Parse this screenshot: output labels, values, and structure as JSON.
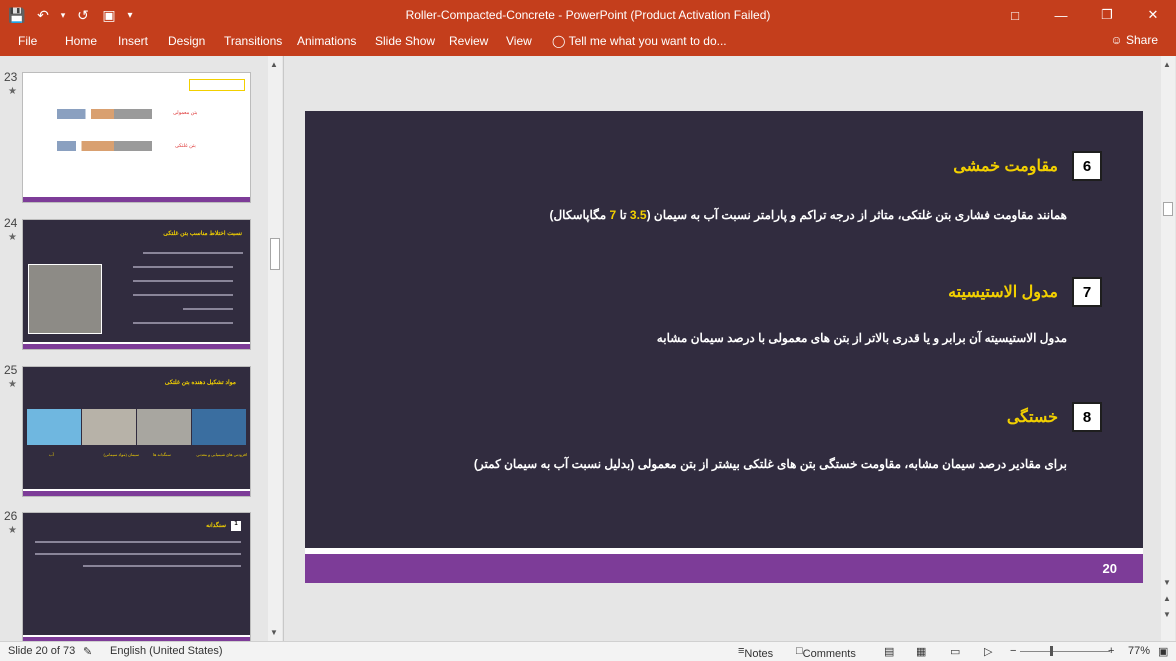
{
  "titlebar": {
    "title": "Roller-Compacted-Concrete - PowerPoint (Product Activation Failed)",
    "save_icon": "save-icon",
    "undo_icon": "undo-icon",
    "redo_icon": "redo-icon",
    "present_icon": "present-icon"
  },
  "ribbon": {
    "tabs": [
      "File",
      "Home",
      "Insert",
      "Design",
      "Transitions",
      "Animations",
      "Slide Show",
      "Review",
      "View"
    ],
    "tell_me": "Tell me what you want to do...",
    "share": "Share"
  },
  "thumbnails": [
    {
      "number": "23",
      "star": "★",
      "label_top": "بتن معمولی",
      "label_bottom": "بتن غلتکی"
    },
    {
      "number": "24",
      "star": "★",
      "title": "نسبت اختلاط مناسب بتن غلتکی"
    },
    {
      "number": "25",
      "star": "★",
      "title": "مواد تشکیل دهنده بتن غلتکی",
      "captions": [
        "افزودنی های شیمیایی و معدنی",
        "سنگدانه ها",
        "سیمان (مواد سیمانی)",
        "آب"
      ]
    },
    {
      "number": "26",
      "star": "★",
      "title": "سنگدانه",
      "num": "1"
    }
  ],
  "slide": {
    "items": [
      {
        "num": "6",
        "heading": "مقاومت خمشی",
        "body_pre": "همانند مقاومت فشاری بتن غلتکی، متاثر از درجه تراکم و پارامتر نسبت آب به سیمان (",
        "v1": "3.5",
        "mid": " تا ",
        "v2": "7",
        "body_post": " مگاپاسکال)"
      },
      {
        "num": "7",
        "heading": "مدول الاستیسیته",
        "body": "مدول الاستیسیته آن برابر و یا قدری بالاتر از بتن های معمولی با درصد سیمان مشابه"
      },
      {
        "num": "8",
        "heading": "خستگی",
        "body": "برای مقادیر درصد سیمان مشابه، مقاومت خستگی بتن های غلتکی بیشتر از بتن معمولی (بدلیل نسبت آب به سیمان کمتر)"
      }
    ],
    "page_number": "20",
    "colors": {
      "background": "#312c3f",
      "accent": "#f2d000",
      "band": "#7d3c98"
    }
  },
  "status": {
    "slide": "Slide 20 of 73",
    "language": "English (United States)",
    "notes": "Notes",
    "comments": "Comments",
    "zoom": "77%"
  }
}
